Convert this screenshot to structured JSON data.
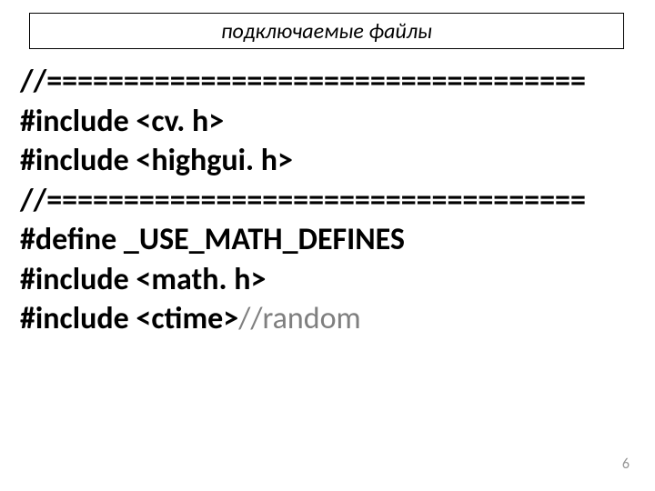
{
  "title": "подключаемые файлы",
  "code": {
    "line1": "//===================================",
    "line2_a": "#include <cv. h>",
    "line3_a": "#include <highgui. h>",
    "line4": "//===================================",
    "line5": "#define _USE_MATH_DEFINES",
    "line6": "#include <math. h>",
    "line7_a": "#include <ctime>",
    "line7_b": "//random"
  },
  "page_number": "6"
}
